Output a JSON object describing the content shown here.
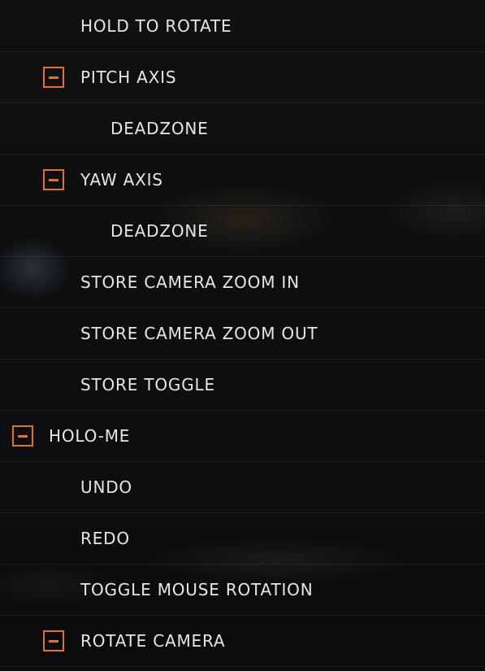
{
  "colors": {
    "accent": "#e8721c",
    "text": "#e6e6e6",
    "background": "#0b0d0f"
  },
  "rows": [
    {
      "label": "HOLD TO ROTATE",
      "toggle": false,
      "icon": "collapse-minus-icon"
    },
    {
      "label": "PITCH AXIS",
      "toggle": true,
      "icon": "collapse-minus-icon"
    },
    {
      "label": "DEADZONE",
      "toggle": false,
      "icon": "collapse-minus-icon"
    },
    {
      "label": "YAW AXIS",
      "toggle": true,
      "icon": "collapse-minus-icon"
    },
    {
      "label": "DEADZONE",
      "toggle": false,
      "icon": "collapse-minus-icon"
    },
    {
      "label": "STORE CAMERA ZOOM IN",
      "toggle": false,
      "icon": "collapse-minus-icon"
    },
    {
      "label": "STORE CAMERA ZOOM OUT",
      "toggle": false,
      "icon": "collapse-minus-icon"
    },
    {
      "label": "STORE TOGGLE",
      "toggle": false,
      "icon": "collapse-minus-icon"
    },
    {
      "label": "HOLO-ME",
      "toggle": true,
      "icon": "collapse-minus-icon"
    },
    {
      "label": "UNDO",
      "toggle": false,
      "icon": "collapse-minus-icon"
    },
    {
      "label": "REDO",
      "toggle": false,
      "icon": "collapse-minus-icon"
    },
    {
      "label": "TOGGLE MOUSE ROTATION",
      "toggle": false,
      "icon": "collapse-minus-icon"
    },
    {
      "label": "ROTATE CAMERA",
      "toggle": true,
      "icon": "collapse-minus-icon"
    }
  ]
}
